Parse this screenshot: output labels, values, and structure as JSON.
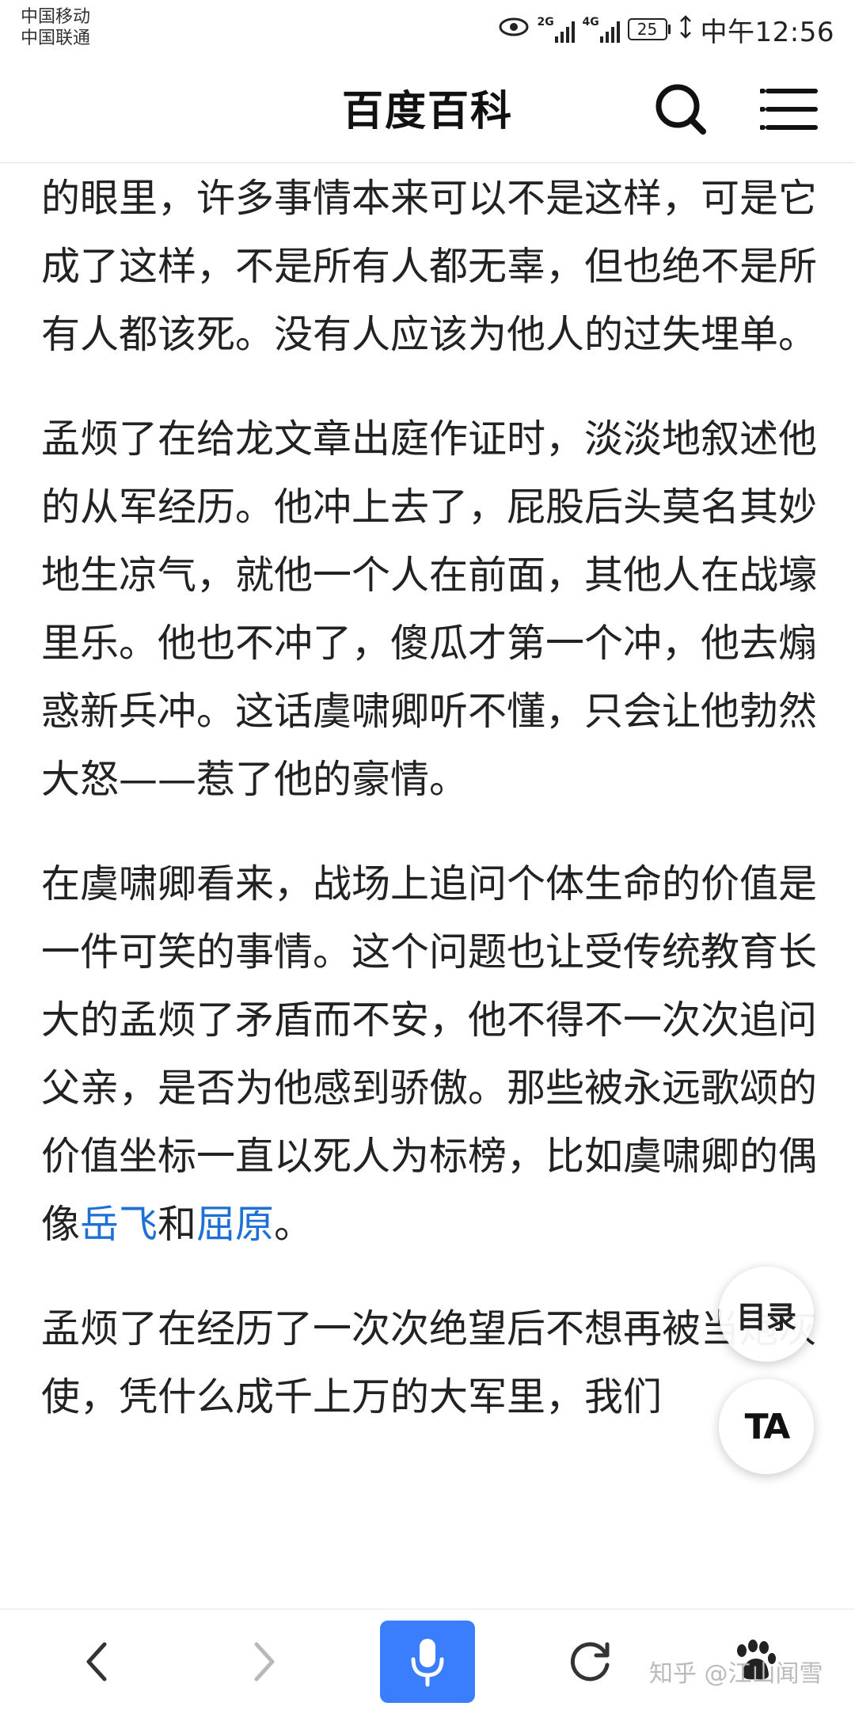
{
  "status_bar": {
    "carrier_1": "中国移动",
    "carrier_2": "中国联通",
    "network_1": "2G",
    "network_2": "4G",
    "battery": "25",
    "time": "中午12:56",
    "icons": [
      "eye-icon",
      "signal-icon",
      "battery-icon",
      "charging-icon"
    ]
  },
  "header": {
    "title": "百度百科",
    "icons": [
      "search-icon",
      "menu-icon"
    ]
  },
  "article": {
    "paragraphs": [
      "的眼里，许多事情本来可以不是这样，可是它成了这样，不是所有人都无辜，但也绝不是所有人都该死。没有人应该为他人的过失埋单。",
      "孟烦了在给龙文章出庭作证时，淡淡地叙述他的从军经历。他冲上去了，屁股后头莫名其妙地生凉气，就他一个人在前面，其他人在战壕里乐。他也不冲了，傻瓜才第一个冲，他去煽惑新兵冲。这话虞啸卿听不懂，只会让他勃然大怒——惹了他的豪情。",
      "孟烦了在经历了一次次绝望后不想再被当炮灰使，凭什么成千上万的大军里，我们"
    ],
    "paragraph_3": {
      "text": "在虞啸卿看来，战场上追问个体生命的价值是一件可笑的事情。这个问题也让受传统教育长大的孟烦了矛盾而不安，他不得不一次次追问父亲，是否为他感到骄傲。那些被永远歌颂的价值坐标一直以死人为标榜，比如虞啸卿的偶像",
      "link_1": "岳飞",
      "joiner": "和",
      "link_2": "屈原",
      "end": "。"
    }
  },
  "floating": {
    "toc_label": "目录",
    "ta_label": "TA"
  },
  "bottom_nav": {
    "icons": [
      "back-icon",
      "forward-icon",
      "mic-icon",
      "refresh-icon",
      "paw-icon"
    ],
    "watermark": "知乎 @江山闻雪"
  },
  "colors": {
    "link": "#1e6fd6",
    "mic_button": "#3a7dfd"
  }
}
